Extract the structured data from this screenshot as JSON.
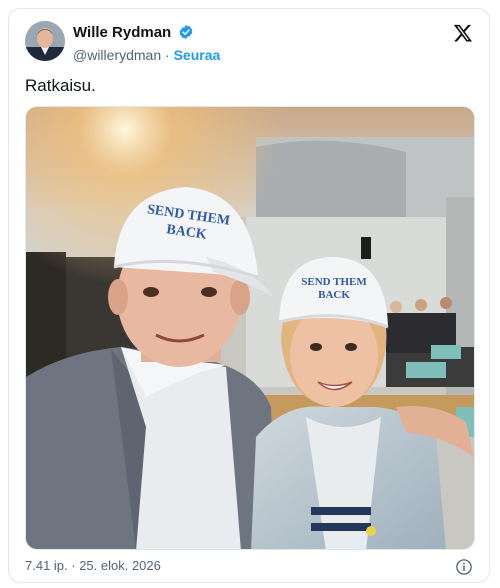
{
  "author": {
    "display_name": "Wille Rydman",
    "handle": "@willerydman",
    "separator": "·",
    "follow_label": "Seuraa",
    "verified": true
  },
  "tweet": {
    "text": "Ratkaisu."
  },
  "media": {
    "description_icon": "photo-image",
    "cap_text_line1": "SEND THEM",
    "cap_text_line2": "BACK"
  },
  "footer": {
    "timestamp": "7.41 ip. · 25. elok. 2026"
  },
  "colors": {
    "accent": "#1d9bf0",
    "secondary_text": "#536471",
    "text": "#0f1419"
  },
  "icons": {
    "verified": "verified-badge-icon",
    "brand": "x-logo-icon",
    "info": "info-icon"
  }
}
